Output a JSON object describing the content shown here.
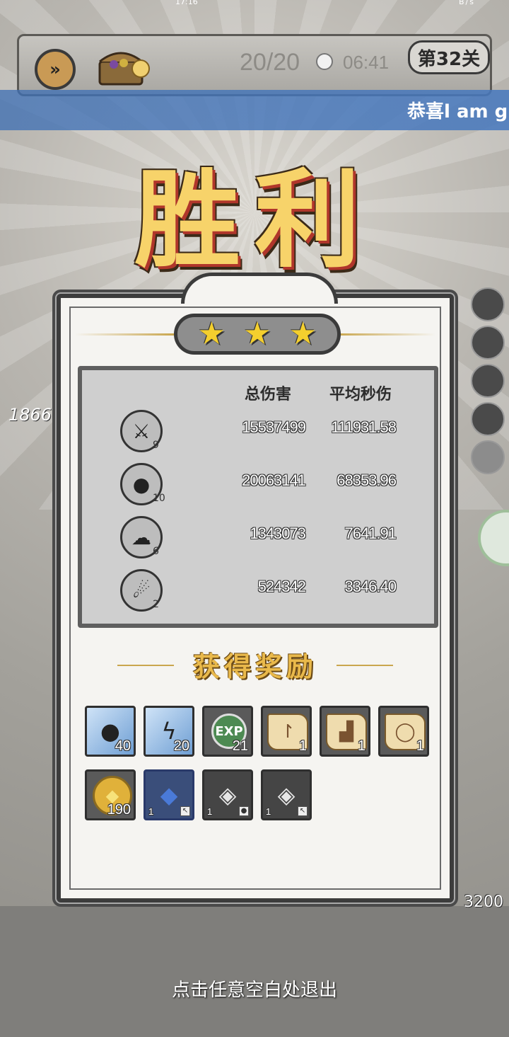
{
  "status": {
    "time": "17:16",
    "right": "B/s"
  },
  "hud": {
    "wave": "20/20",
    "timer": "06:41",
    "level": "第32关",
    "fast_forward_icon": "fast-forward-icon",
    "chest_icon": "treasure-chest-icon"
  },
  "banner": {
    "text": "恭喜l am g"
  },
  "victory": {
    "title": "胜利"
  },
  "side": {
    "left_number": "1866",
    "castle_hp": "3200"
  },
  "panel": {
    "stars": 3,
    "stats": {
      "headers": {
        "total": "总伤害",
        "dps": "平均秒伤"
      },
      "rows": [
        {
          "icon": "daggers-skill-icon",
          "glyph": "⚔",
          "level": "9",
          "total": "15537499",
          "dps": "111931.58"
        },
        {
          "icon": "bomb-skill-icon",
          "glyph": "●",
          "level": "10",
          "total": "20063141",
          "dps": "68353.96"
        },
        {
          "icon": "ghost-skill-icon",
          "glyph": "☁",
          "level": "6",
          "total": "1343073",
          "dps": "7641.91"
        },
        {
          "icon": "meteor-skill-icon",
          "glyph": "☄",
          "level": "2",
          "total": "524342",
          "dps": "3346.40"
        }
      ]
    },
    "rewards_title": "获得奖励",
    "rewards": [
      {
        "name": "bomb-card-icon",
        "type": "ice",
        "glyph": "●",
        "count": "40"
      },
      {
        "name": "lightning-card-icon",
        "type": "ice",
        "glyph": "ϟ",
        "count": "20"
      },
      {
        "name": "exp-orb-icon",
        "type": "exp",
        "glyph": "EXP",
        "count": "21"
      },
      {
        "name": "weapon-scroll-icon",
        "type": "scroll",
        "glyph": "↾",
        "count": "1"
      },
      {
        "name": "boot-scroll-icon",
        "type": "scroll",
        "glyph": "▟",
        "count": "1"
      },
      {
        "name": "ring-scroll-icon",
        "type": "scroll",
        "glyph": "◯",
        "count": "1"
      },
      {
        "name": "gold-coin-icon",
        "type": "gold",
        "glyph": "◆",
        "count": "190"
      },
      {
        "name": "blue-crystal-icon",
        "type": "crystal",
        "glyph": "◆",
        "count": "1",
        "corner": "↖"
      },
      {
        "name": "silver-ore-icon",
        "type": "ore",
        "glyph": "◈",
        "count": "1",
        "corner": "●"
      },
      {
        "name": "silver-ore-icon-2",
        "type": "ore",
        "glyph": "◈",
        "count": "1",
        "corner": "↖"
      }
    ]
  },
  "footer": {
    "exit_hint": "点击任意空白处退出"
  }
}
